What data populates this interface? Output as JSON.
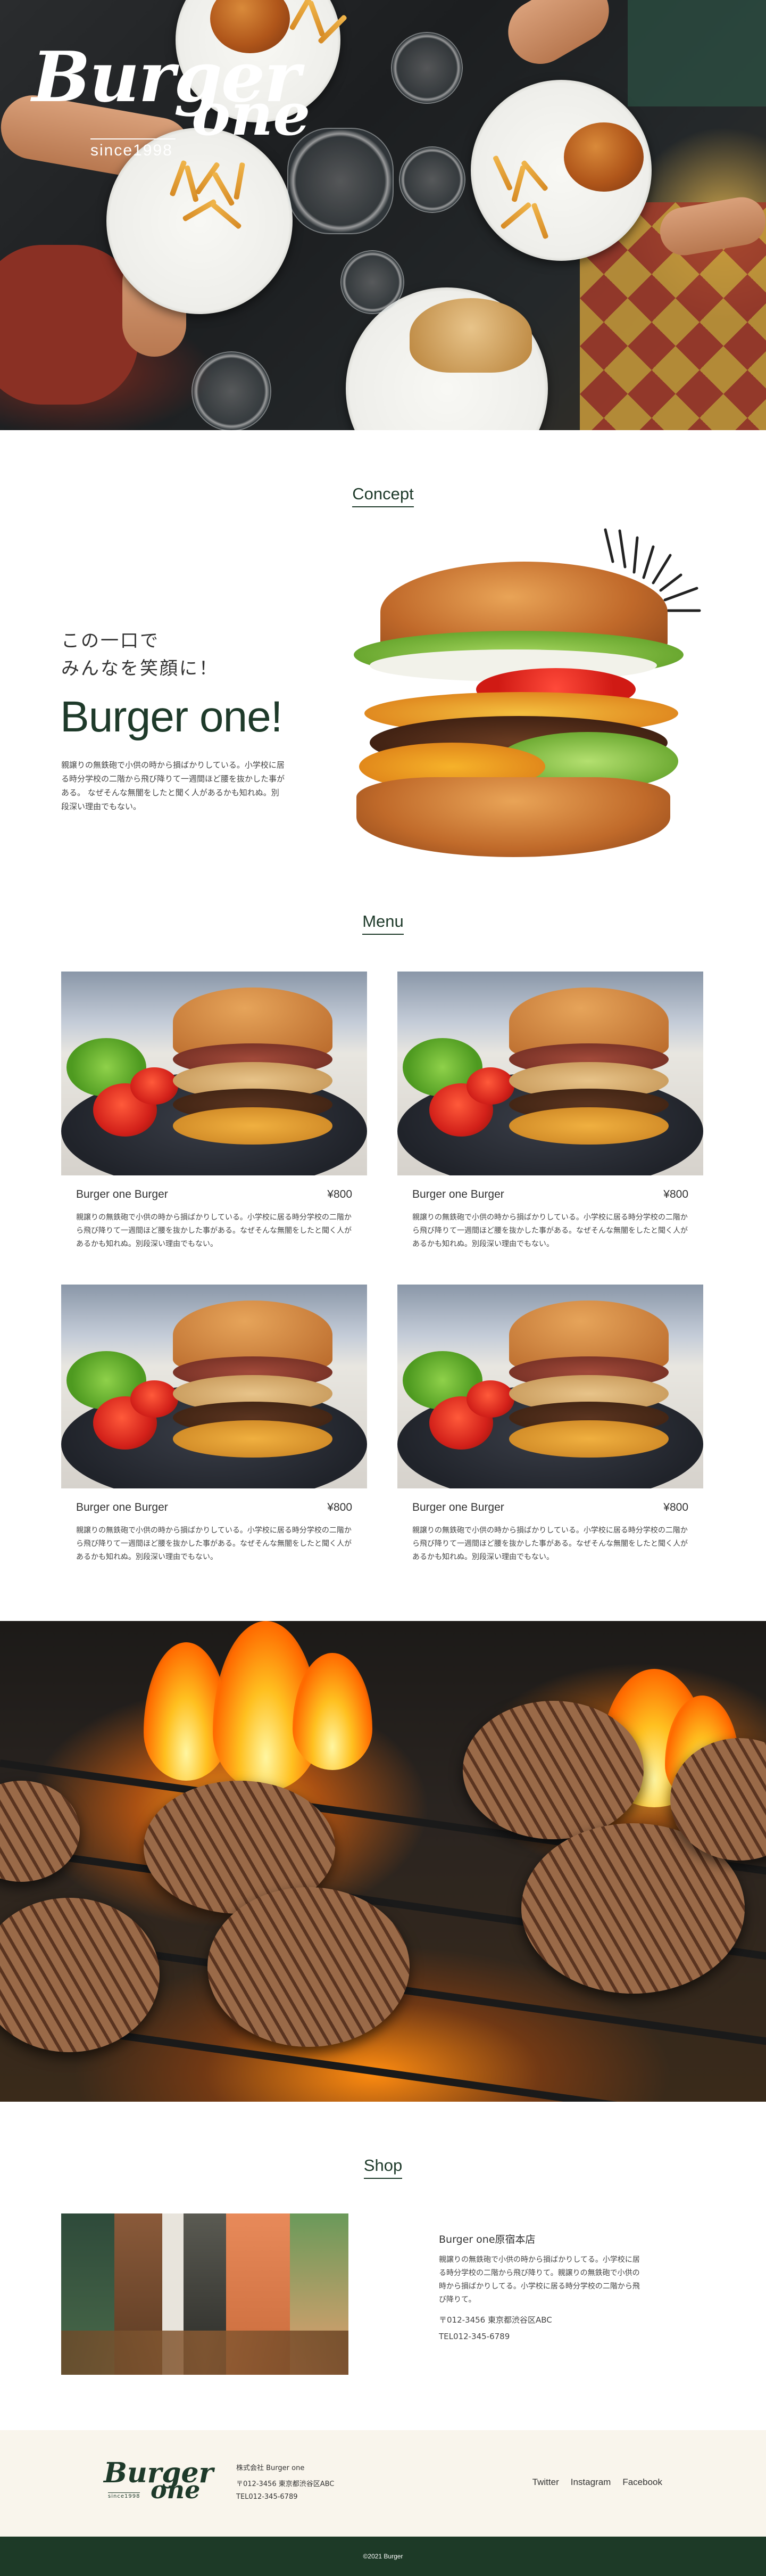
{
  "hero": {
    "logo_line1": "Burger",
    "logo_line2": "one",
    "logo_since": "since1998"
  },
  "concept": {
    "title": "Concept",
    "catch_line1": "この一口で",
    "catch_line2": "みんなを笑顔に！",
    "name": "Burger one!",
    "body": "親譲りの無鉄砲で小供の時から損ばかりしている。小学校に居る時分学校の二階から飛び降りて一週間ほど腰を抜かした事がある。 なぜそんな無闇をしたと聞く人があるかも知れぬ。別段深い理由でもない。"
  },
  "menu": {
    "title": "Menu",
    "items": [
      {
        "name": "Burger one Burger",
        "price": "¥800",
        "desc": "親譲りの無鉄砲で小供の時から損ばかりしている。小学校に居る時分学校の二階から飛び降りて一週間ほど腰を抜かした事がある。なぜそんな無闇をしたと聞く人があるかも知れぬ。別段深い理由でもない。"
      },
      {
        "name": "Burger one Burger",
        "price": "¥800",
        "desc": "親譲りの無鉄砲で小供の時から損ばかりしている。小学校に居る時分学校の二階から飛び降りて一週間ほど腰を抜かした事がある。なぜそんな無闇をしたと聞く人があるかも知れぬ。別段深い理由でもない。"
      },
      {
        "name": "Burger one Burger",
        "price": "¥800",
        "desc": "親譲りの無鉄砲で小供の時から損ばかりしている。小学校に居る時分学校の二階から飛び降りて一週間ほど腰を抜かした事がある。なぜそんな無闇をしたと聞く人があるかも知れぬ。別段深い理由でもない。"
      },
      {
        "name": "Burger one Burger",
        "price": "¥800",
        "desc": "親譲りの無鉄砲で小供の時から損ばかりしている。小学校に居る時分学校の二階から飛び降りて一週間ほど腰を抜かした事がある。なぜそんな無闇をしたと聞く人があるかも知れぬ。別段深い理由でもない。"
      }
    ]
  },
  "shop": {
    "title": "Shop",
    "name": "Burger one原宿本店",
    "desc": "親譲りの無鉄砲で小供の時から損ばかりしてる。小学校に居る時分学校の二階から飛び降りて。親譲りの無鉄砲で小供の時から損ばかりしてる。小学校に居る時分学校の二階から飛び降りて。",
    "address": "〒012-3456 東京都渋谷区ABC",
    "tel": "TEL012-345-6789"
  },
  "footer": {
    "logo_line1": "Burger",
    "logo_line2": "one",
    "logo_since": "since1998",
    "company": "株式会社 Burger one",
    "address": "〒012-3456 東京都渋谷区ABC",
    "tel": "TEL012-345-6789",
    "links": [
      "Twitter",
      "Instagram",
      "Facebook"
    ],
    "copyright": "©2021 Burger"
  },
  "colors": {
    "accent_green": "#1d3a27",
    "footer_bg": "#f9f5ec"
  }
}
